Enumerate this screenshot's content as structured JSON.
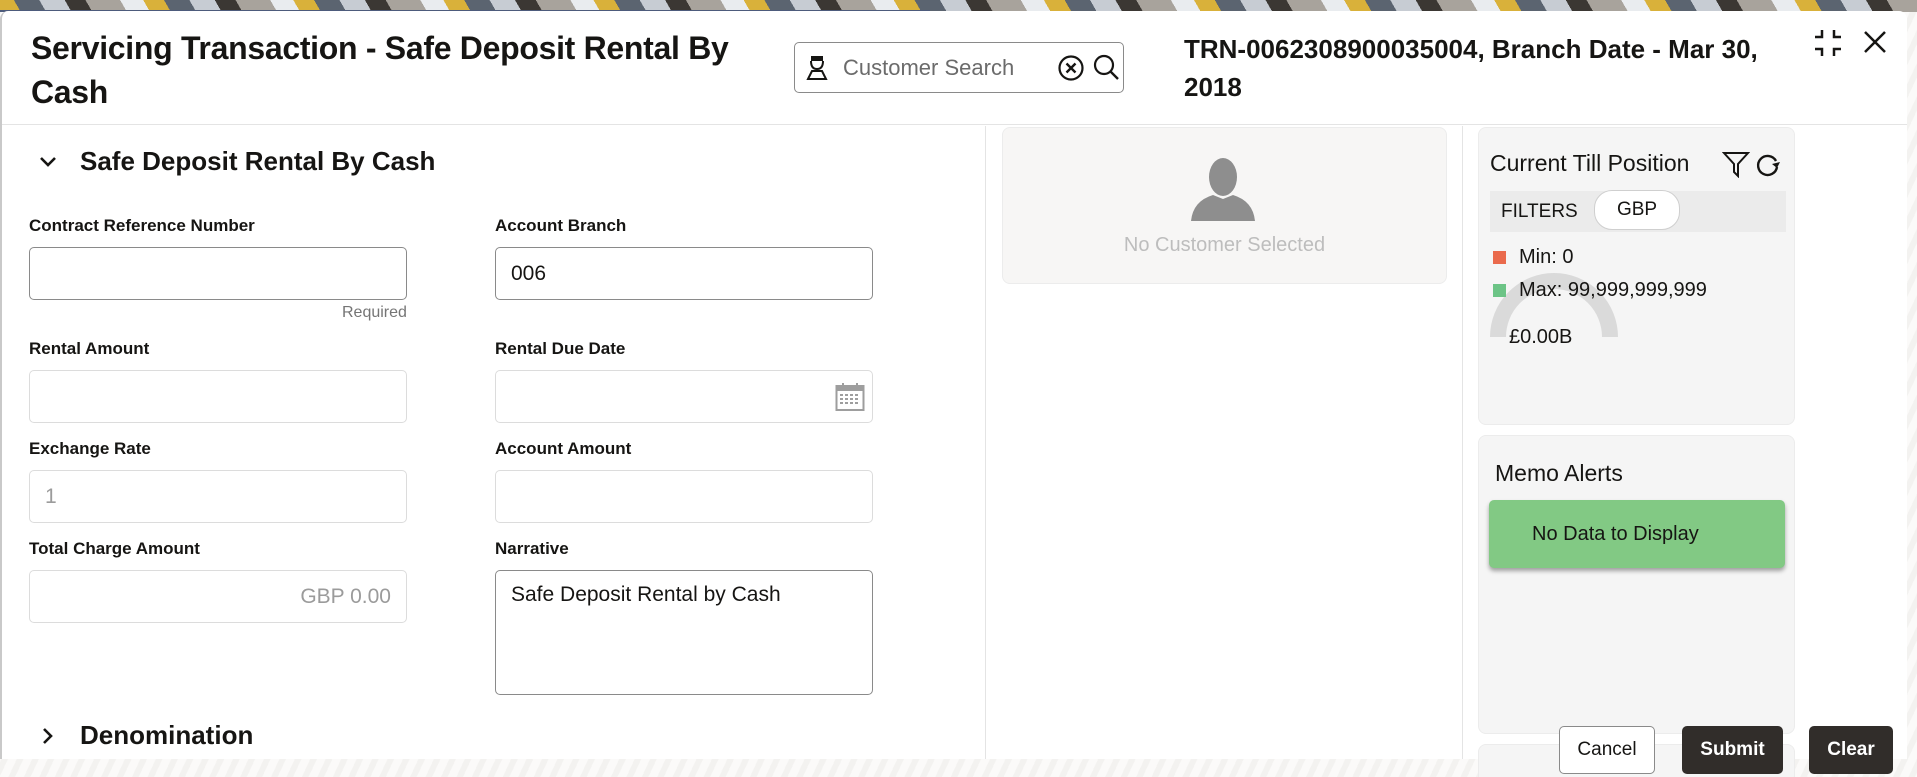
{
  "header": {
    "title": "Servicing Transaction - Safe Deposit Rental By Cash",
    "search": {
      "placeholder": "Customer Search",
      "value": ""
    },
    "transaction_info": "TRN-0062308900035004, Branch Date - Mar 30, 2018",
    "icons": [
      "customer-icon",
      "clear-circle-icon",
      "search-icon",
      "collapse-icon",
      "close-icon"
    ]
  },
  "sections": {
    "main": {
      "title": "Safe Deposit Rental By Cash",
      "expanded": true
    },
    "denomination": {
      "title": "Denomination",
      "expanded": false
    }
  },
  "fields": {
    "contract_reference_number": {
      "label": "Contract Reference Number",
      "value": "",
      "helper": "Required"
    },
    "account_branch": {
      "label": "Account Branch",
      "value": "006"
    },
    "rental_amount": {
      "label": "Rental Amount",
      "value": ""
    },
    "rental_due_date": {
      "label": "Rental Due Date",
      "value": ""
    },
    "exchange_rate": {
      "label": "Exchange Rate",
      "value": "1"
    },
    "account_amount": {
      "label": "Account Amount",
      "value": ""
    },
    "total_charge_amount": {
      "label": "Total Charge Amount",
      "value": "GBP 0.00"
    },
    "narrative": {
      "label": "Narrative",
      "value": "Safe Deposit Rental by Cash"
    }
  },
  "customer": {
    "empty_text": "No Customer Selected"
  },
  "till_position": {
    "title": "Current Till Position",
    "filters_label": "FILTERS",
    "currency_filter": "GBP",
    "legend": [
      {
        "label": "Min: 0",
        "color": "#ea6a4c"
      },
      {
        "label": "Max: 99,999,999,999",
        "color": "#6cc486"
      }
    ],
    "gauge_value_label": "£0.00B",
    "gauge_fraction": 0
  },
  "memo_alerts": {
    "title": "Memo Alerts",
    "empty_text": "No Data to Display",
    "box_color": "#82c984"
  },
  "actions": {
    "cancel": "Cancel",
    "submit": "Submit",
    "clear": "Clear"
  }
}
